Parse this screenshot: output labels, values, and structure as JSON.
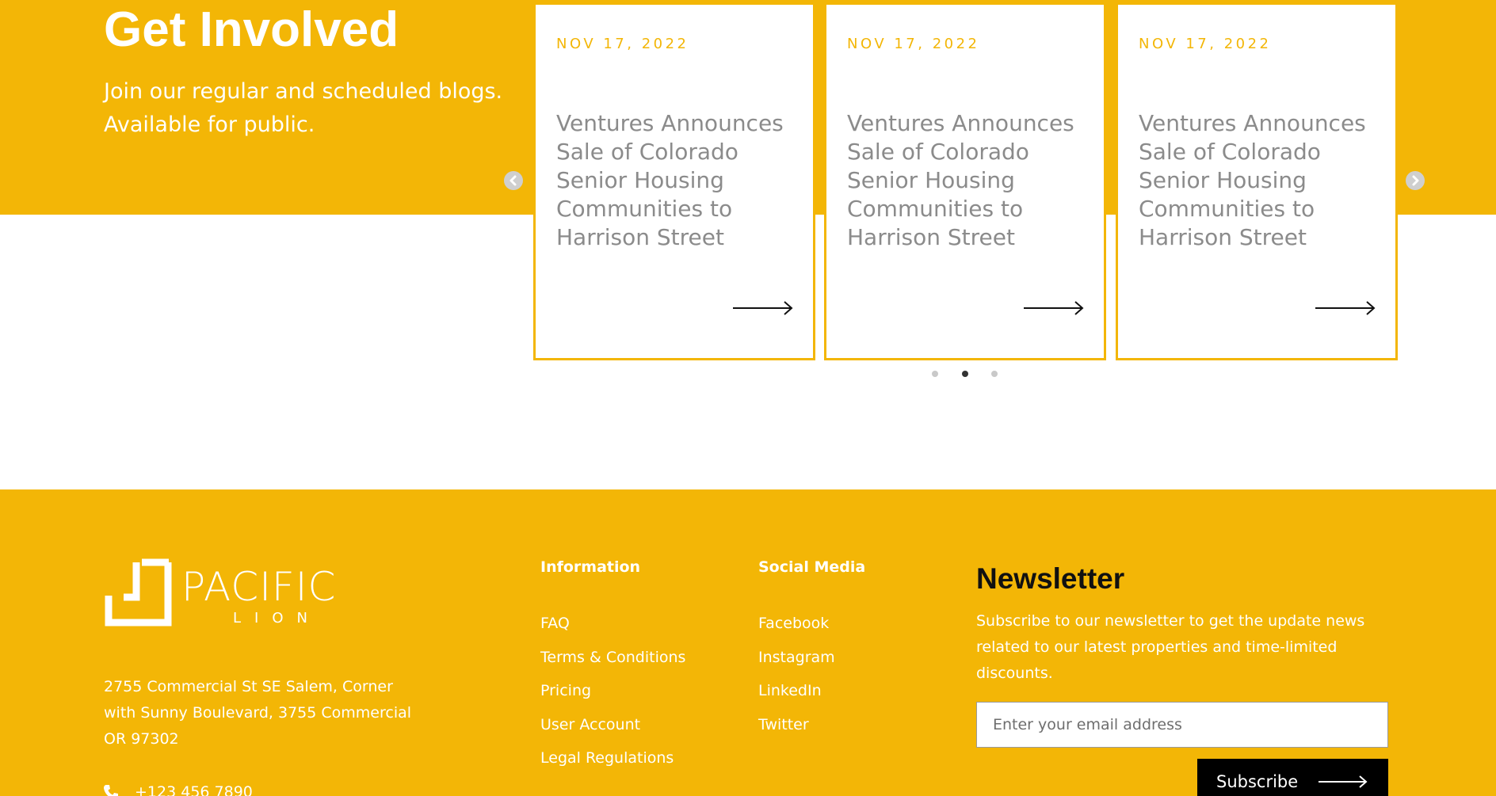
{
  "hero": {
    "title": "Get Involved",
    "subtitle": "Join our regular and scheduled blogs. Available for public."
  },
  "carousel": {
    "cards": [
      {
        "date": "NOV 17, 2022",
        "title": "Ventures Announces Sale of Colorado Senior Housing Communities to Harrison Street"
      },
      {
        "date": "NOV 17, 2022",
        "title": "Ventures Announces Sale of Colorado Senior Housing Communities to Harrison Street"
      },
      {
        "date": "NOV 17, 2022",
        "title": "Ventures Announces Sale of Colorado Senior Housing Communities to Harrison Street"
      }
    ],
    "active_dot": 2,
    "dot_count": 3
  },
  "footer": {
    "logo_text": "PACIFIC",
    "logo_sub": "LION",
    "address": "2755 Commercial St SE Salem, Corner with Sunny Boulevard, 3755 Commercial OR 97302",
    "phone": "+123 456 7890",
    "information": {
      "title": "Information",
      "links": [
        "FAQ",
        "Terms & Conditions",
        "Pricing",
        "User Account",
        "Legal Regulations"
      ]
    },
    "social": {
      "title": "Social Media",
      "links": [
        "Facebook",
        "Instagram",
        "LinkedIn",
        "Twitter"
      ]
    },
    "newsletter": {
      "title": "Newsletter",
      "text": "Subscribe to our newsletter to get the update news related to our latest properties and time-limited discounts.",
      "placeholder": "Enter your email address",
      "button_label": "Subscribe"
    }
  },
  "colors": {
    "brand_yellow": "#f3b606",
    "card_text": "#8b8b8b",
    "button_bg": "#000000"
  },
  "icons": [
    "chevron-left-icon",
    "chevron-right-icon",
    "arrow-right-icon",
    "phone-icon"
  ]
}
